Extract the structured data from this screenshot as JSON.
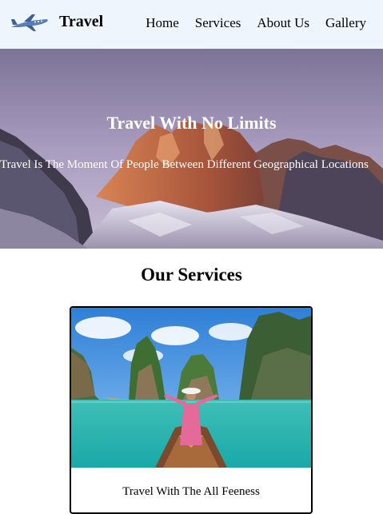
{
  "header": {
    "logo_icon": "airplane-icon",
    "brand": "Travel",
    "nav": [
      "Home",
      "Services",
      "About Us",
      "Gallery"
    ]
  },
  "hero": {
    "title": "Travel With No Limits",
    "subtitle": "Travel Is The Moment Of People Between Different Geographical Locations"
  },
  "services": {
    "heading": "Our Services",
    "cards": [
      {
        "caption": "Travel With The All Feeness"
      }
    ]
  },
  "colors": {
    "header_bg": "#eef5fc",
    "hero_text": "#ffffff"
  }
}
